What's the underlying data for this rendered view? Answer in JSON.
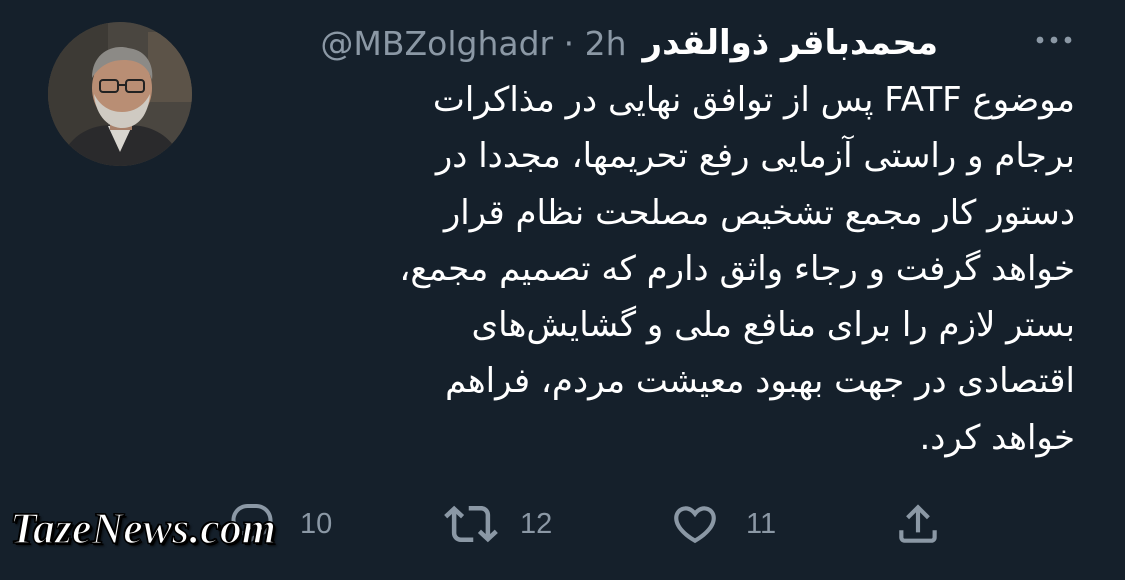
{
  "tweet": {
    "author": {
      "display_name": "محمدباقر ذوالقدر",
      "handle": "@MBZolghadr",
      "separator": "·",
      "time": "2h"
    },
    "text": "موضوع FATF پس از توافق نهایی در مذاکرات\nبرجام و راستی آزمایی رفع تحریمها، مجددا در\nدستور کار مجمع تشخیص مصلحت نظام قرار\nخواهد گرفت و رجاء واثق دارم که تصمیم مجمع،\nبستر لازم را برای منافع ملی و گشایش‌های\nاقتصادی در جهت بهبود معیشت مردم، فراهم\nخواهد کرد.",
    "actions": {
      "reply": {
        "icon": "reply-icon",
        "count": "10"
      },
      "retweet": {
        "icon": "retweet-icon",
        "count": "12"
      },
      "like": {
        "icon": "heart-icon",
        "count": "11"
      },
      "share": {
        "icon": "share-icon"
      }
    },
    "more_icon": "more-icon"
  },
  "watermark": {
    "text": "TazeNews.com"
  },
  "colors": {
    "background": "#15202b",
    "text_primary": "#ffffff",
    "text_secondary": "#8b98a5"
  }
}
